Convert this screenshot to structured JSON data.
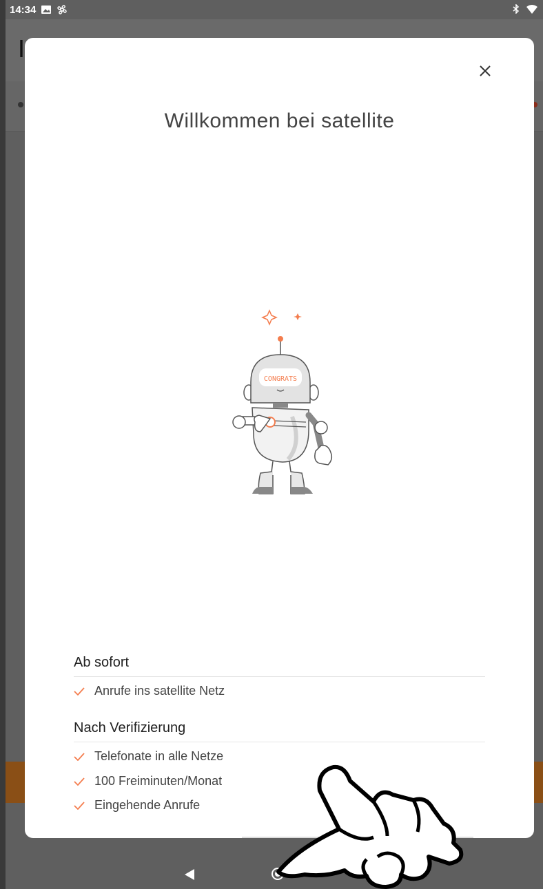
{
  "status_bar": {
    "time": "14:34",
    "left_icons": [
      "image-icon",
      "pinwheel-icon"
    ],
    "right_icons": [
      "bluetooth-icon",
      "wifi-icon"
    ]
  },
  "background_app": {
    "title_fragment": "I"
  },
  "modal": {
    "close_label": "×",
    "title": "Willkommen bei satellite",
    "robot": {
      "screen_text": "CONGRATS"
    },
    "sections": [
      {
        "title": "Ab sofort",
        "items": [
          "Anrufe ins satellite Netz"
        ]
      },
      {
        "title": "Nach Verifizierung",
        "items": [
          "Telefonate in alle Netze",
          "100 Freiminuten/Monat",
          "Eingehende Anrufe"
        ]
      }
    ]
  },
  "nav_bar": {
    "buttons": [
      "back-icon",
      "home-icon"
    ]
  },
  "colors": {
    "accent": "#F47D4E",
    "background_dim": "#5F5F5F",
    "modal_bg": "#FFFFFF",
    "text": "#444444"
  }
}
